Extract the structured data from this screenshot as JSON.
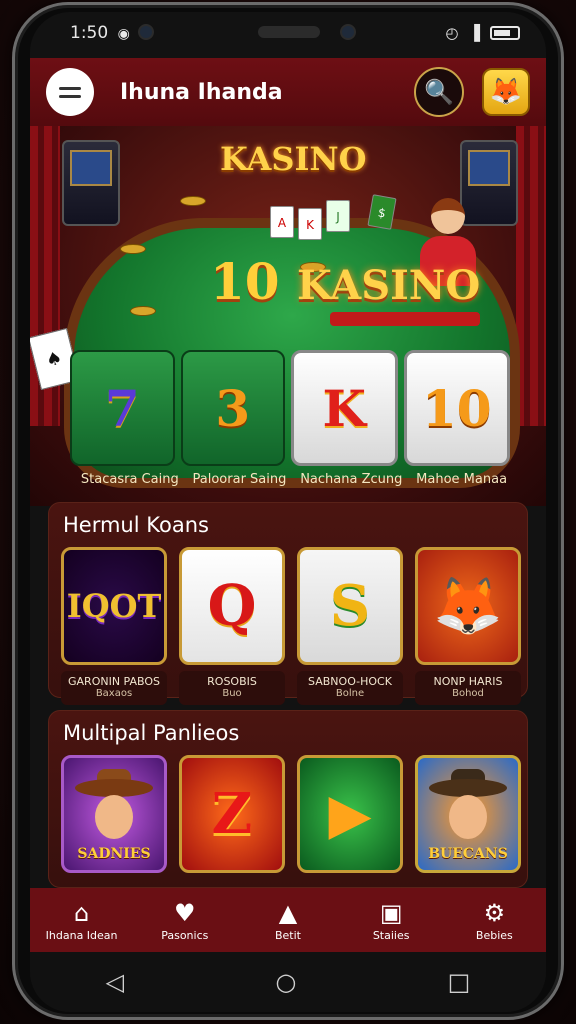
{
  "status": {
    "time": "1:50",
    "signal": "◉",
    "wifi": "◴",
    "bars": "▐"
  },
  "header": {
    "title": "Ihuna Ihanda",
    "search_icon": "🔍",
    "avatar_icon": "🦊"
  },
  "hero": {
    "logo": "KASINO",
    "headline_number": "10",
    "headline_word": "KASINO",
    "reels": [
      {
        "symbol": "7",
        "style": "blue"
      },
      {
        "symbol": "3",
        "style": "orange"
      },
      {
        "symbol": "K",
        "style": "red"
      },
      {
        "symbol": "10",
        "style": "orange"
      }
    ],
    "reel_labels": [
      "Stacasra Caing",
      "Paloorar Saing",
      "Nachana Zcung",
      "Mahoe Manaa"
    ]
  },
  "section1": {
    "title": "Hermul Koans",
    "tiles": [
      {
        "art": "IQOT",
        "line1": "GARONIN PABOS",
        "line2": "Baxaos"
      },
      {
        "art": "Q",
        "line1": "ROSOBIS",
        "line2": "Buo"
      },
      {
        "art": "S",
        "line1": "SABNOO-HOCK",
        "line2": "Bolne"
      },
      {
        "art": "🦊",
        "line1": "NONP HARIS",
        "line2": "Bohod"
      }
    ]
  },
  "section2": {
    "title": "Multipal Panlieos",
    "tiles": [
      {
        "art": "SADNIES"
      },
      {
        "art": "Z"
      },
      {
        "art": "▶"
      },
      {
        "art": "BUECANS"
      }
    ]
  },
  "nav": [
    {
      "icon": "⌂",
      "label": "Ihdana Idean"
    },
    {
      "icon": "♥",
      "label": "Pasonics"
    },
    {
      "icon": "▲",
      "label": "Betit"
    },
    {
      "icon": "▣",
      "label": "Staiies"
    },
    {
      "icon": "⚙",
      "label": "Bebies"
    }
  ],
  "system_nav": {
    "back": "◁",
    "home": "○",
    "recents": "□"
  }
}
